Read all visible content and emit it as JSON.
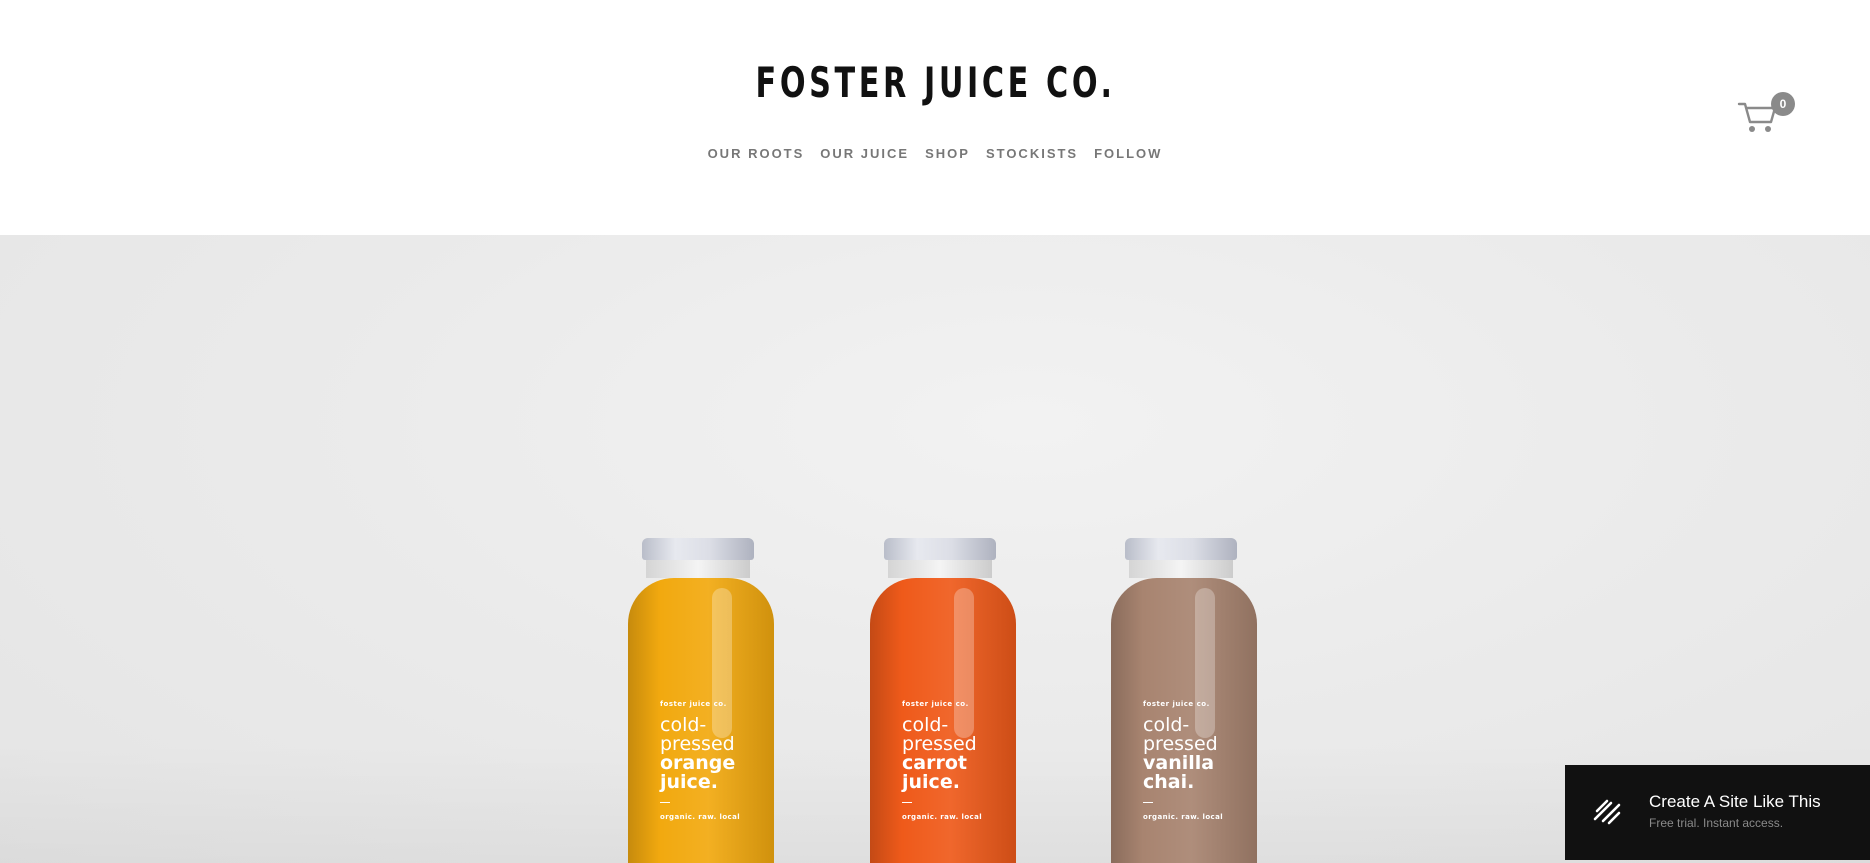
{
  "header": {
    "brand": "FOSTER JUICE CO.",
    "nav": [
      {
        "label": "OUR ROOTS"
      },
      {
        "label": "OUR JUICE"
      },
      {
        "label": "SHOP"
      },
      {
        "label": "STOCKISTS"
      },
      {
        "label": "FOLLOW"
      }
    ],
    "cart": {
      "icon": "cart-icon",
      "count": "0"
    }
  },
  "hero": {
    "bottles": [
      {
        "brand": "foster juice co.",
        "line1": "cold-",
        "line2": "pressed",
        "line3": "orange",
        "line4": "juice.",
        "tag": "organic. raw. local",
        "color": "#f2a90f"
      },
      {
        "brand": "foster juice co.",
        "line1": "cold-",
        "line2": "pressed",
        "line3": "carrot",
        "line4": "juice.",
        "tag": "organic. raw. local",
        "color": "#ef5a1a"
      },
      {
        "brand": "foster juice co.",
        "line1": "cold-",
        "line2": "pressed",
        "line3": "vanilla",
        "line4": "chai.",
        "tag": "organic. raw. local",
        "color": "#a88470"
      }
    ]
  },
  "promo": {
    "icon": "squarespace-logo-icon",
    "title": "Create A Site Like This",
    "subtitle": "Free trial. Instant access."
  }
}
